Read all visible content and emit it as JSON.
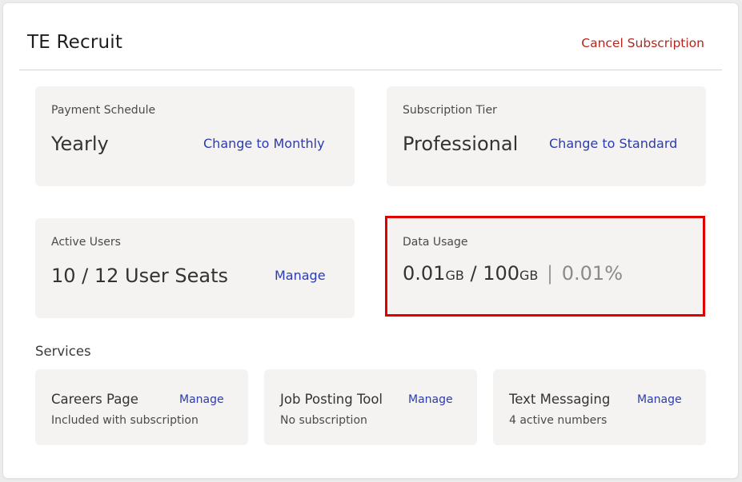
{
  "header": {
    "title": "TE Recruit",
    "cancel_label": "Cancel Subscription"
  },
  "payment": {
    "label": "Payment Schedule",
    "value": "Yearly",
    "action": "Change to Monthly"
  },
  "tier": {
    "label": "Subscription Tier",
    "value": "Professional",
    "action": "Change to Standard"
  },
  "users": {
    "label": "Active Users",
    "value": "10 / 12 User Seats",
    "action": "Manage"
  },
  "usage": {
    "label": "Data Usage",
    "used": "0.01",
    "used_unit": "GB",
    "slash": "/",
    "total": "100",
    "total_unit": "GB",
    "separator": "|",
    "percent": "0.01%"
  },
  "services": {
    "title": "Services",
    "items": [
      {
        "name": "Careers Page",
        "manage": "Manage",
        "status": "Included with subscription"
      },
      {
        "name": "Job Posting Tool",
        "manage": "Manage",
        "status": "No subscription"
      },
      {
        "name": "Text Messaging",
        "manage": "Manage",
        "status": "4 active numbers"
      }
    ]
  },
  "colors": {
    "accent_link": "#2b3bb0",
    "danger": "#b3261e",
    "highlight_border": "#e00000",
    "panel_bg": "#f4f3f1"
  }
}
